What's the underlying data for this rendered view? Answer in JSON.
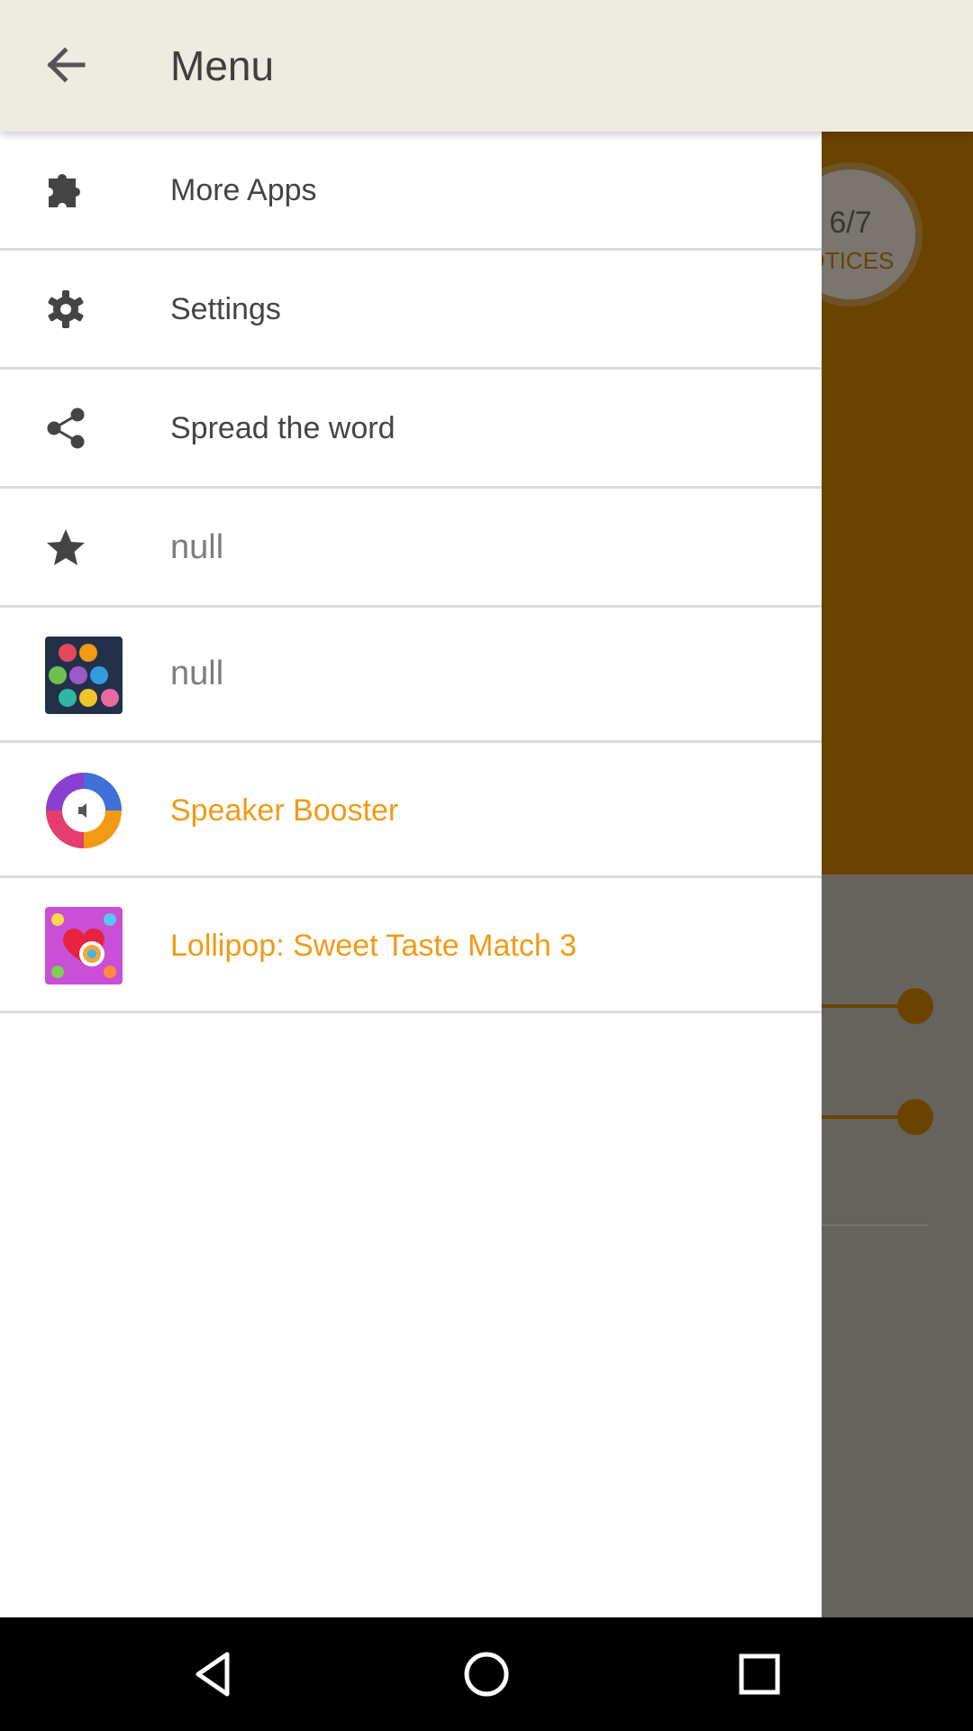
{
  "appbar": {
    "title": "Menu",
    "back_icon": "arrow-back-icon"
  },
  "drawer": {
    "items": [
      {
        "label": "More Apps",
        "icon": "puzzle-icon"
      },
      {
        "label": "Settings",
        "icon": "gear-icon"
      },
      {
        "label": "Spread the word",
        "icon": "share-icon"
      },
      {
        "label": "null",
        "icon": "star-icon"
      },
      {
        "label": "null",
        "icon": "hexagon-numbers-app-icon"
      },
      {
        "label": "Speaker Booster",
        "icon": "speaker-booster-app-icon"
      },
      {
        "label": "Lollipop: Sweet Taste Match 3",
        "icon": "lollipop-candy-app-icon"
      }
    ]
  },
  "background": {
    "badge_count": "6/7",
    "badge_label": "OTICES"
  },
  "colors": {
    "accent": "#f39a14",
    "appbar": "#eeebe1",
    "background_brown": "#6b4300"
  },
  "navbar": {
    "buttons": [
      "back-triangle-icon",
      "home-circle-icon",
      "recents-square-icon"
    ]
  }
}
